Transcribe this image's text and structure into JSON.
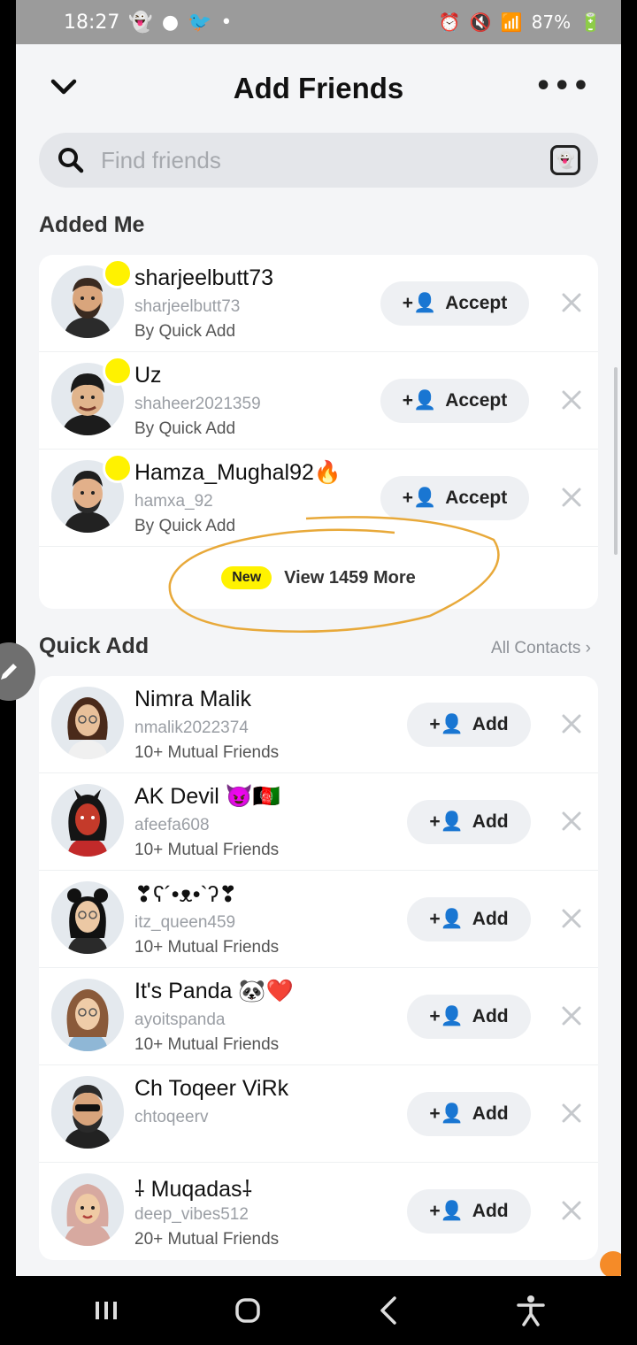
{
  "status_bar": {
    "time": "18:27",
    "left_icons": [
      "snapchat-icon",
      "snap-icon",
      "twitter-icon",
      "dot-icon"
    ],
    "right_icons": [
      "alarm-icon",
      "mute-icon",
      "wifi-icon",
      "signal-icon",
      "volte-icon",
      "signal-icon"
    ],
    "battery": "87%"
  },
  "header": {
    "title": "Add Friends"
  },
  "search": {
    "placeholder": "Find friends"
  },
  "added_me": {
    "title": "Added Me",
    "items": [
      {
        "name": "sharjeelbutt73",
        "username": "sharjeelbutt73",
        "meta": "By Quick Add",
        "action": "Accept"
      },
      {
        "name": "Uz",
        "username": "shaheer2021359",
        "meta": "By Quick Add",
        "action": "Accept"
      },
      {
        "name": "Hamza_Mughal92🔥",
        "username": "hamxa_92",
        "meta": "By Quick Add",
        "action": "Accept"
      }
    ],
    "view_more": {
      "badge": "New",
      "label": "View 1459 More"
    }
  },
  "quick_add": {
    "title": "Quick Add",
    "all_contacts": "All Contacts",
    "items": [
      {
        "name": "Nimra Malik",
        "username": "nmalik2022374",
        "meta": "10+ Mutual Friends",
        "action": "Add"
      },
      {
        "name": "AK Devil 😈🇦🇫",
        "username": "afeefa608",
        "meta": "10+ Mutual Friends",
        "action": "Add"
      },
      {
        "name": "❣ʕ´•ᴥ•`ʔ❣",
        "username": "itz_queen459",
        "meta": "10+ Mutual Friends",
        "action": "Add"
      },
      {
        "name": "It's Panda 🐼❤️",
        "username": "ayoitspanda",
        "meta": "10+ Mutual Friends",
        "action": "Add"
      },
      {
        "name": "Ch Toqeer ViRk",
        "username": "chtoqeerv",
        "meta": "",
        "action": "Add"
      },
      {
        "name": "⸸ Muqadas⸸",
        "username": "deep_vibes512",
        "meta": "20+ Mutual Friends",
        "action": "Add"
      }
    ]
  },
  "colors": {
    "accent_yellow": "#FFF200",
    "background": "#F4F5F7",
    "annotation_circle": "#E8A93A"
  }
}
